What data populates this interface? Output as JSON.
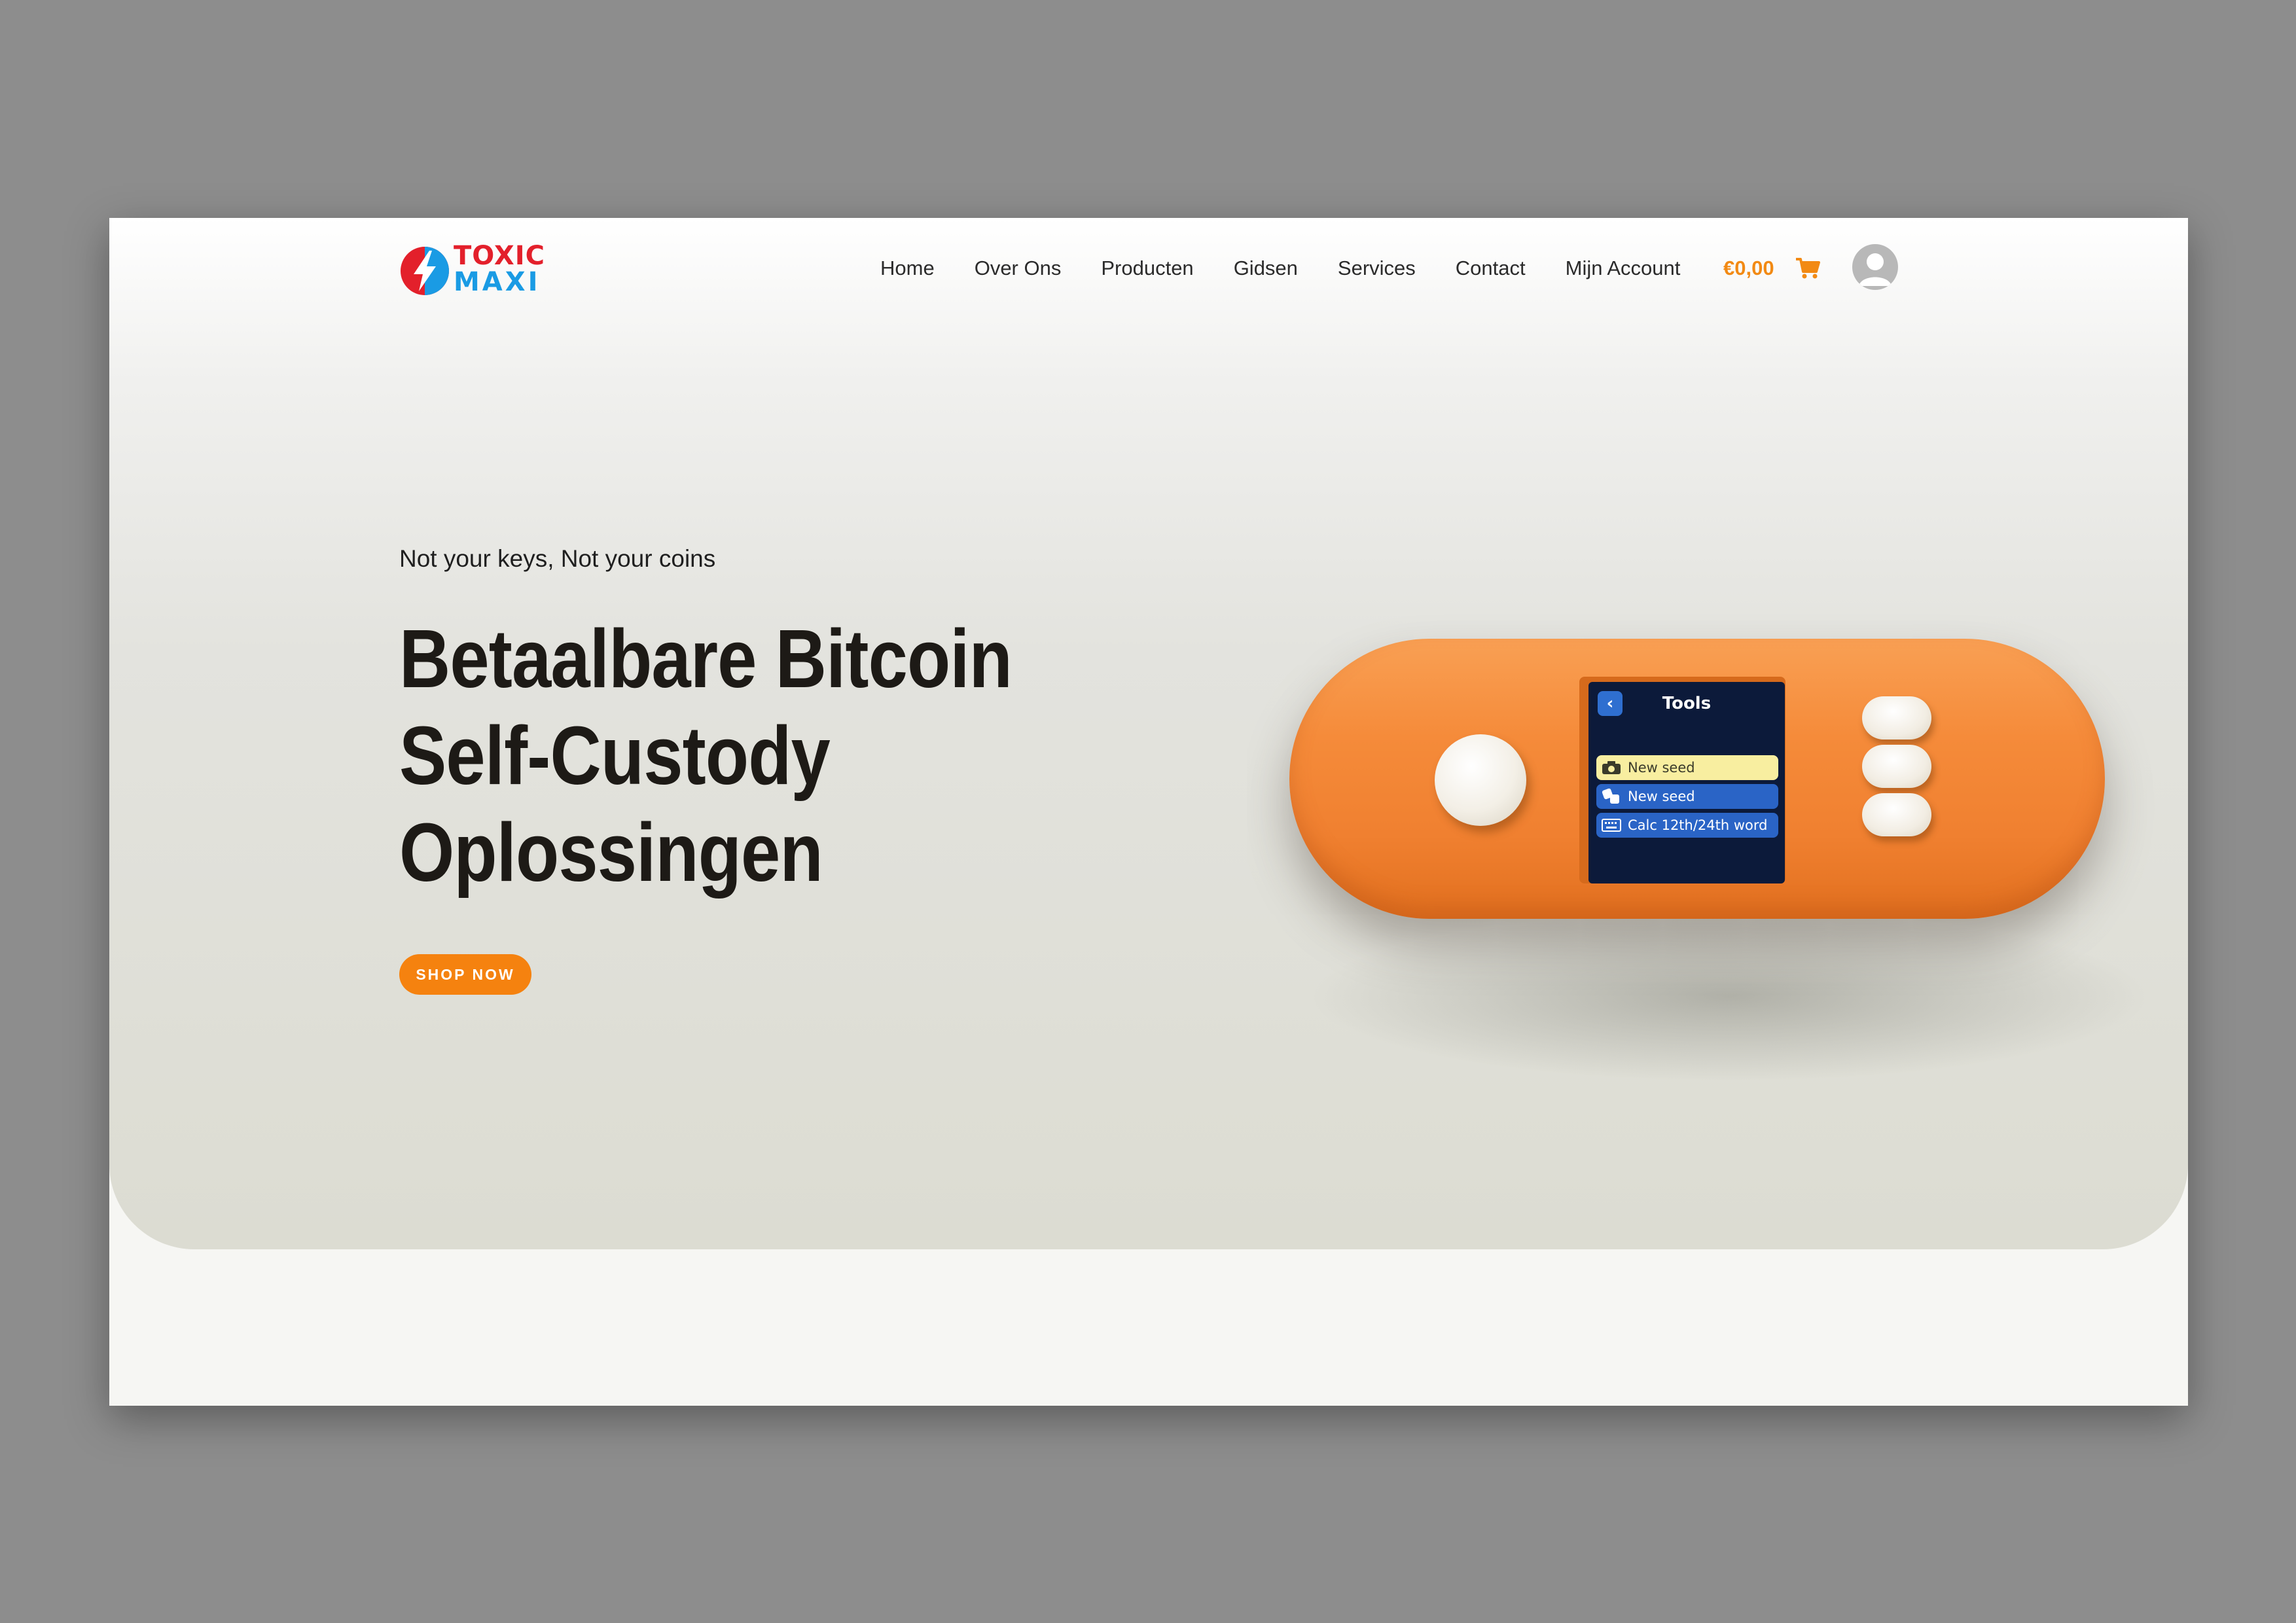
{
  "brand": {
    "line1": "TOXIC",
    "line2": "MAXI",
    "colors": {
      "red": "#e3202b",
      "blue": "#1a9be4"
    }
  },
  "nav": {
    "items": [
      "Home",
      "Over Ons",
      "Producten",
      "Gidsen",
      "Services",
      "Contact",
      "Mijn Account"
    ]
  },
  "cart": {
    "total": "€0,00",
    "icon": "cart-icon"
  },
  "user": {
    "icon": "user-avatar-icon"
  },
  "hero": {
    "tagline": "Not your keys, Not your coins",
    "headline": [
      "Betaalbare Bitcoin",
      "Self-Custody",
      "Oplossingen"
    ],
    "cta_label": "SHOP NOW"
  },
  "device": {
    "screen_title": "Tools",
    "menu": [
      {
        "label": "New seed",
        "icon": "camera-icon",
        "selected": true
      },
      {
        "label": "New seed",
        "icon": "dice-icon",
        "selected": false
      },
      {
        "label": "Calc 12th/24th word",
        "icon": "keyboard-icon",
        "selected": false
      }
    ]
  },
  "colors": {
    "accent": "#f5820f",
    "text": "#1d1a16",
    "device_orange": "#f58b3a",
    "screen_bg": "#0c1a3a"
  }
}
